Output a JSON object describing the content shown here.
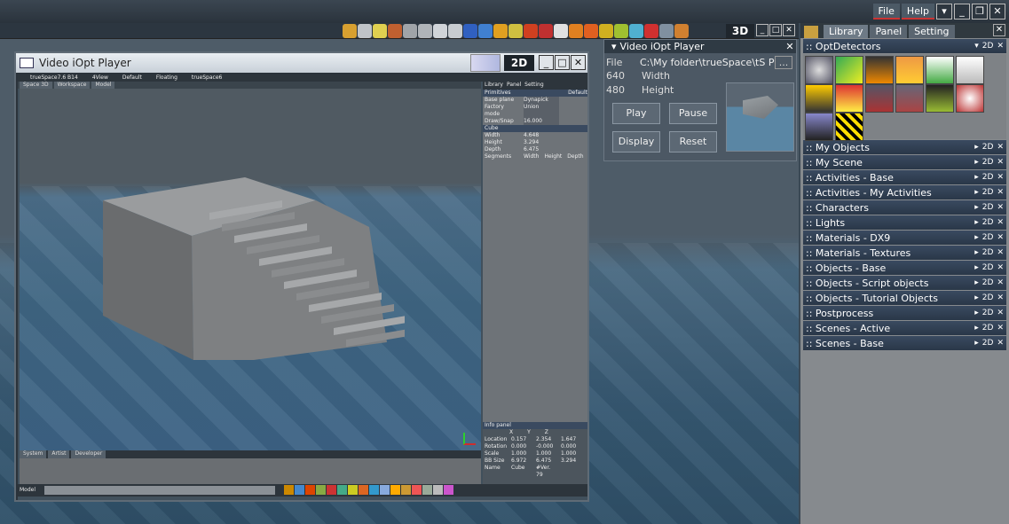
{
  "menu": {
    "file": "File",
    "help": "Help"
  },
  "toolbar": {
    "mode_3d": "3D"
  },
  "player": {
    "title": "Video iOpt Player",
    "file_label": "File",
    "file_value": "C:\\My folder\\trueSpace\\tS Proc",
    "browse": "...",
    "width_value": "640",
    "width_label": "Width",
    "height_value": "480",
    "height_label": "Height",
    "play": "Play",
    "pause": "Pause",
    "display": "Display",
    "reset": "Reset"
  },
  "library": {
    "tabs": [
      "Library",
      "Panel",
      "Setting"
    ],
    "opt_section": ":: OptDetectors",
    "sections": [
      ":: My Objects",
      ":: My Scene",
      ":: Activities - Base",
      ":: Activities - My Activities",
      ":: Characters",
      ":: Lights",
      ":: Materials - DX9",
      ":: Materials - Textures",
      ":: Objects - Base",
      ":: Objects - Script objects",
      ":: Objects - Tutorial Objects",
      ":: Postprocess",
      ":: Scenes - Active",
      ":: Scenes - Base"
    ],
    "section_ctrl": "2D"
  },
  "tswin": {
    "title": "Video iOpt Player",
    "mode_2d": "2D",
    "inner_menu": [
      "trueSpace7.6 B14",
      "4View",
      "Default",
      "Floating",
      "trueSpace6"
    ],
    "inner_tabs": [
      "Space 3D",
      "Workspace",
      "Model"
    ],
    "right_tabs": [
      "Library",
      "Panel",
      "Setting"
    ],
    "primitives_header": "Primitives",
    "primitives_default": "Default",
    "prim_rows": [
      [
        "Base plane",
        "Dynapick"
      ],
      [
        "Factory mode",
        "Union"
      ],
      [
        "Draw/Snap",
        "16.000"
      ]
    ],
    "cube_header": "Cube",
    "cube_rows": [
      [
        "Width",
        "4.648"
      ],
      [
        "Height",
        "3.294"
      ],
      [
        "Depth",
        "6.475"
      ],
      [
        "Segments",
        "Width",
        "Height",
        "Depth"
      ]
    ],
    "info_header": "Info panel",
    "info_cols": [
      "X",
      "Y",
      "Z"
    ],
    "info_rows": [
      [
        "Location",
        "0.157",
        "2.354",
        "1.647"
      ],
      [
        "Rotation",
        "0.000",
        "-0.000",
        "0.000"
      ],
      [
        "Scale",
        "1.000",
        "1.000",
        "1.000"
      ],
      [
        "BB Size",
        "6.972",
        "6.475",
        "3.294"
      ],
      [
        "Name",
        "Cube",
        "#Ver. 79",
        ""
      ]
    ],
    "bottom_tabs": [
      "System",
      "Artist",
      "Developer"
    ],
    "status_label": "Model"
  },
  "colors": {
    "accent_red": "#cc3333",
    "panel_blue": "#2a3748"
  }
}
